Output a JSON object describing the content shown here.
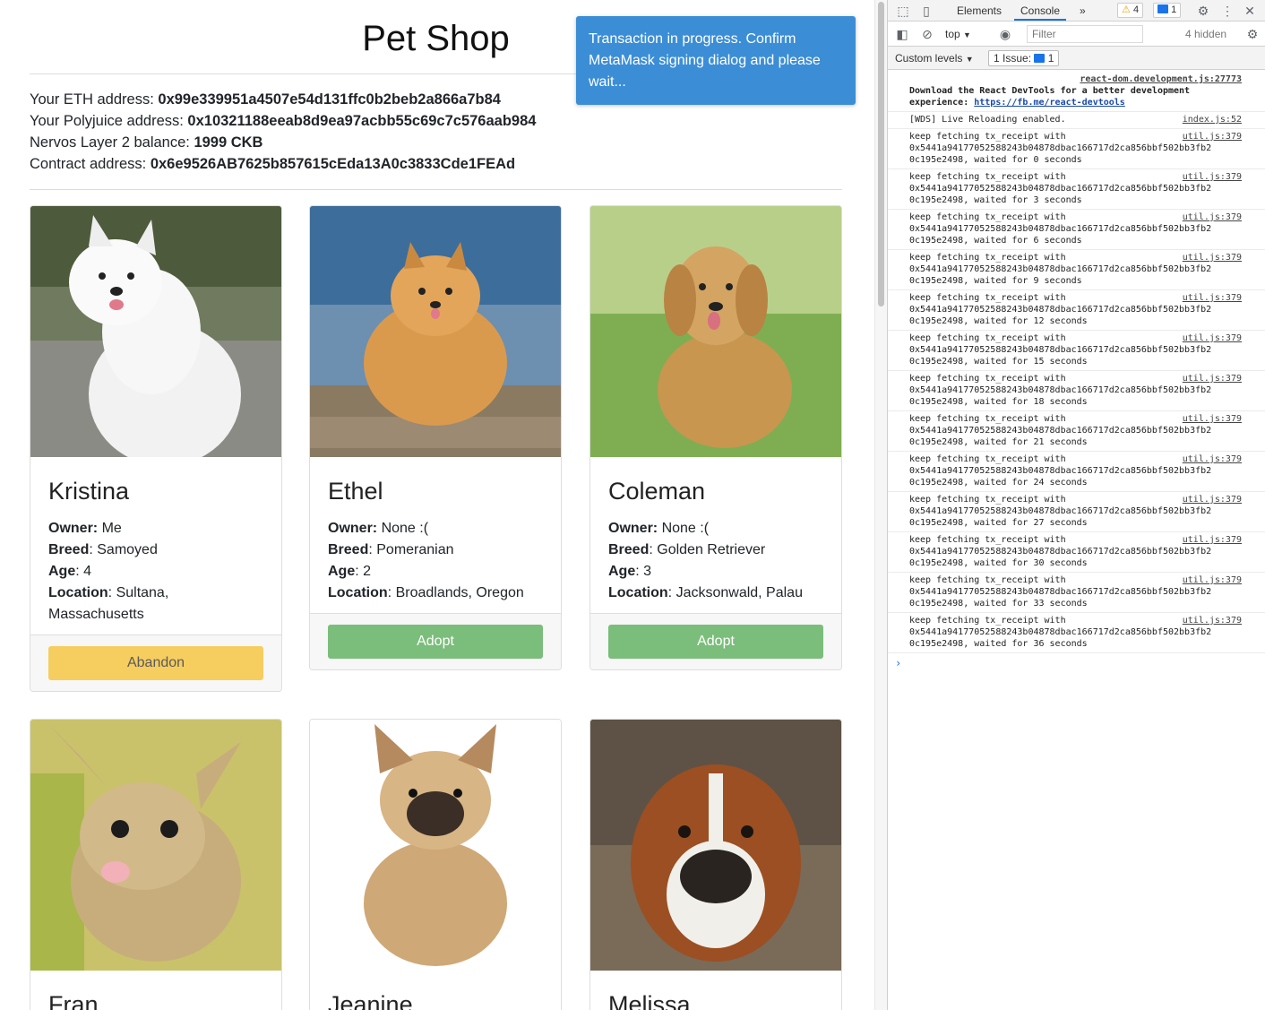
{
  "app": {
    "title": "Pet Shop",
    "info": [
      {
        "label": "Your ETH address: ",
        "value": "0x99e339951a4507e54d131ffc0b2beb2a866a7b84"
      },
      {
        "label": "Your Polyjuice address: ",
        "value": "0x10321188eeab8d9ea97acbb55c69c7c576aab984"
      },
      {
        "label": "Nervos Layer 2 balance: ",
        "value": "1999 CKB"
      },
      {
        "label": "Contract address: ",
        "value": "0x6e9526AB7625b857615cEda13A0c3833Cde1FEAd"
      }
    ],
    "toast": "Transaction in progress. Confirm MetaMask signing dialog and please wait...",
    "labels": {
      "owner": "Owner:",
      "breed": "Breed",
      "age": "Age",
      "location": "Location"
    },
    "pets": [
      {
        "name": "Kristina",
        "owner": "Me",
        "breed": "Samoyed",
        "age": "4",
        "location": "Sultana, Massachusetts",
        "action": "Abandon",
        "photo": "white-samoyed-dog"
      },
      {
        "name": "Ethel",
        "owner": "None :(",
        "breed": "Pomeranian",
        "age": "2",
        "location": "Broadlands, Oregon",
        "action": "Adopt",
        "photo": "orange-pomeranian-dog"
      },
      {
        "name": "Coleman",
        "owner": "None :(",
        "breed": "Golden Retriever",
        "age": "3",
        "location": "Jacksonwald, Palau",
        "action": "Adopt",
        "photo": "golden-retriever-dog"
      },
      {
        "name": "Fran",
        "photo": "pikachu-like-creature"
      },
      {
        "name": "Jeanine",
        "photo": "french-bulldog"
      },
      {
        "name": "Melissa",
        "photo": "boxer-dog"
      }
    ]
  },
  "devtools": {
    "tabs": [
      "Elements",
      "Console"
    ],
    "active_tab": "Console",
    "more_tabs": "»",
    "warnings_count": "4",
    "messages_count": "1",
    "context": "top",
    "filter_placeholder": "Filter",
    "hidden": "4 hidden",
    "levels": "Custom levels",
    "issues": "1 Issue:",
    "issues_count": "1",
    "messages": [
      {
        "text": "Download the React DevTools for a better development\nexperience: ",
        "link": "https://fb.me/react-devtools",
        "source": "react-dom.development.js:27773",
        "bold": true
      },
      {
        "text": "[WDS] Live Reloading enabled.",
        "source": "index.js:52"
      },
      {
        "text": "keep fetching tx_receipt with\n0x5441a94177052588243b04878dbac166717d2ca856bbf502bb3fb2\n0c195e2498, waited for 0 seconds",
        "source": "util.js:379"
      },
      {
        "text": "keep fetching tx_receipt with\n0x5441a94177052588243b04878dbac166717d2ca856bbf502bb3fb2\n0c195e2498, waited for 3 seconds",
        "source": "util.js:379"
      },
      {
        "text": "keep fetching tx_receipt with\n0x5441a94177052588243b04878dbac166717d2ca856bbf502bb3fb2\n0c195e2498, waited for 6 seconds",
        "source": "util.js:379"
      },
      {
        "text": "keep fetching tx_receipt with\n0x5441a94177052588243b04878dbac166717d2ca856bbf502bb3fb2\n0c195e2498, waited for 9 seconds",
        "source": "util.js:379"
      },
      {
        "text": "keep fetching tx_receipt with\n0x5441a94177052588243b04878dbac166717d2ca856bbf502bb3fb2\n0c195e2498, waited for 12 seconds",
        "source": "util.js:379"
      },
      {
        "text": "keep fetching tx_receipt with\n0x5441a94177052588243b04878dbac166717d2ca856bbf502bb3fb2\n0c195e2498, waited for 15 seconds",
        "source": "util.js:379"
      },
      {
        "text": "keep fetching tx_receipt with\n0x5441a94177052588243b04878dbac166717d2ca856bbf502bb3fb2\n0c195e2498, waited for 18 seconds",
        "source": "util.js:379"
      },
      {
        "text": "keep fetching tx_receipt with\n0x5441a94177052588243b04878dbac166717d2ca856bbf502bb3fb2\n0c195e2498, waited for 21 seconds",
        "source": "util.js:379"
      },
      {
        "text": "keep fetching tx_receipt with\n0x5441a94177052588243b04878dbac166717d2ca856bbf502bb3fb2\n0c195e2498, waited for 24 seconds",
        "source": "util.js:379"
      },
      {
        "text": "keep fetching tx_receipt with\n0x5441a94177052588243b04878dbac166717d2ca856bbf502bb3fb2\n0c195e2498, waited for 27 seconds",
        "source": "util.js:379"
      },
      {
        "text": "keep fetching tx_receipt with\n0x5441a94177052588243b04878dbac166717d2ca856bbf502bb3fb2\n0c195e2498, waited for 30 seconds",
        "source": "util.js:379"
      },
      {
        "text": "keep fetching tx_receipt with\n0x5441a94177052588243b04878dbac166717d2ca856bbf502bb3fb2\n0c195e2498, waited for 33 seconds",
        "source": "util.js:379"
      },
      {
        "text": "keep fetching tx_receipt with\n0x5441a94177052588243b04878dbac166717d2ca856bbf502bb3fb2\n0c195e2498, waited for 36 seconds",
        "source": "util.js:379"
      }
    ],
    "prompt": "›"
  }
}
